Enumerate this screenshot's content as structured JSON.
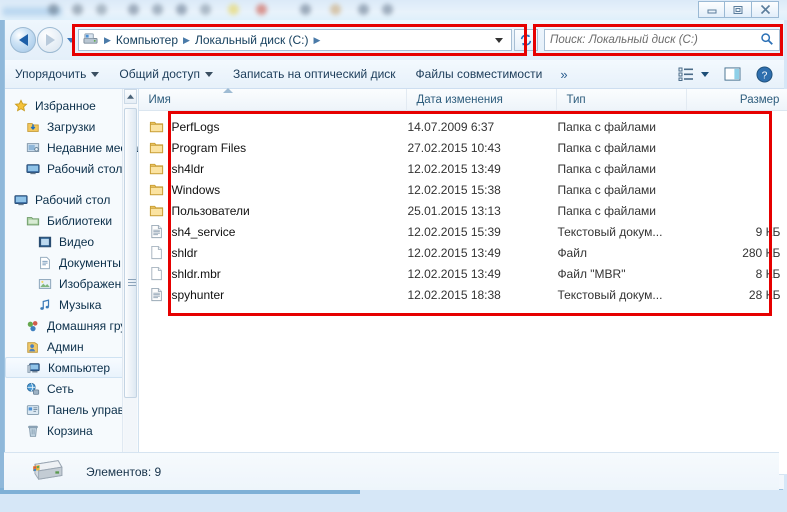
{
  "window": {
    "controls": {
      "minimize": "minimize-button",
      "maximize": "maximize-button",
      "close": "close-button"
    }
  },
  "address_bar": {
    "icon": "computer-drive-icon",
    "crumbs": [
      "Компьютер",
      "Локальный диск (C:)"
    ],
    "separator": "▶",
    "dropdown": "history-dropdown",
    "refresh_label": "Обновить",
    "back_label": "Назад",
    "forward_label": "Вперёд"
  },
  "search": {
    "placeholder": "Поиск: Локальный диск (C:)",
    "icon": "search-icon"
  },
  "toolbar": {
    "organize": "Упорядочить",
    "share": "Общий доступ",
    "burn": "Записать на оптический диск",
    "compat": "Файлы совместимости",
    "overflow": "»",
    "view_icon": "view-list-icon",
    "preview_icon": "preview-pane-icon",
    "help_icon": "help-icon"
  },
  "sidebar": {
    "groups": [
      {
        "items": [
          {
            "label": "Избранное",
            "icon": "star-icon",
            "indent": 0,
            "selected": false
          },
          {
            "label": "Загрузки",
            "icon": "downloads-icon",
            "indent": 1,
            "selected": false
          },
          {
            "label": "Недавние места",
            "icon": "recent-places-icon",
            "indent": 1,
            "selected": false
          },
          {
            "label": "Рабочий стол",
            "icon": "desktop-icon",
            "indent": 1,
            "selected": false
          }
        ]
      },
      {
        "items": [
          {
            "label": "Рабочий стол",
            "icon": "desktop-icon",
            "indent": 0,
            "selected": false
          },
          {
            "label": "Библиотеки",
            "icon": "libraries-icon",
            "indent": 1,
            "selected": false
          },
          {
            "label": "Видео",
            "icon": "video-icon",
            "indent": 2,
            "selected": false
          },
          {
            "label": "Документы",
            "icon": "documents-icon",
            "indent": 2,
            "selected": false
          },
          {
            "label": "Изображения",
            "icon": "pictures-icon",
            "indent": 2,
            "selected": false
          },
          {
            "label": "Музыка",
            "icon": "music-icon",
            "indent": 2,
            "selected": false
          },
          {
            "label": "Домашняя груп",
            "icon": "homegroup-icon",
            "indent": 1,
            "selected": false
          },
          {
            "label": "Админ",
            "icon": "user-icon",
            "indent": 1,
            "selected": false
          },
          {
            "label": "Компьютер",
            "icon": "computer-icon",
            "indent": 1,
            "selected": true
          },
          {
            "label": "Сеть",
            "icon": "network-icon",
            "indent": 1,
            "selected": false
          },
          {
            "label": "Панель управле",
            "icon": "control-panel-icon",
            "indent": 1,
            "selected": false
          },
          {
            "label": "Корзина",
            "icon": "recycle-bin-icon",
            "indent": 1,
            "selected": false
          }
        ]
      }
    ],
    "scrollbar": {
      "up": "scroll-up-arrow",
      "down": "scroll-down-arrow"
    }
  },
  "file_list": {
    "columns": [
      "Имя",
      "Дата изменения",
      "Тип",
      "Размер"
    ],
    "sort_column": "Имя",
    "rows": [
      {
        "name": "PerfLogs",
        "date": "14.07.2009 6:37",
        "type": "Папка с файлами",
        "size": "",
        "icon": "folder-icon"
      },
      {
        "name": "Program Files",
        "date": "27.02.2015 10:43",
        "type": "Папка с файлами",
        "size": "",
        "icon": "folder-icon"
      },
      {
        "name": "sh4ldr",
        "date": "12.02.2015 13:49",
        "type": "Папка с файлами",
        "size": "",
        "icon": "folder-icon"
      },
      {
        "name": "Windows",
        "date": "12.02.2015 15:38",
        "type": "Папка с файлами",
        "size": "",
        "icon": "folder-icon"
      },
      {
        "name": "Пользователи",
        "date": "25.01.2015 13:13",
        "type": "Папка с файлами",
        "size": "",
        "icon": "folder-icon"
      },
      {
        "name": "sh4_service",
        "date": "12.02.2015 15:39",
        "type": "Текстовый докум...",
        "size": "9 КБ",
        "icon": "text-document-icon"
      },
      {
        "name": "shldr",
        "date": "12.02.2015 13:49",
        "type": "Файл",
        "size": "280 КБ",
        "icon": "blank-file-icon"
      },
      {
        "name": "shldr.mbr",
        "date": "12.02.2015 13:49",
        "type": "Файл \"MBR\"",
        "size": "8 КБ",
        "icon": "blank-file-icon"
      },
      {
        "name": "spyhunter",
        "date": "12.02.2015 18:38",
        "type": "Текстовый докум...",
        "size": "28 КБ",
        "icon": "text-document-icon"
      }
    ]
  },
  "status_bar": {
    "text": "Элементов: 9",
    "icon": "local-drive-icon"
  },
  "annotations": {
    "color": "#e60000",
    "boxes": [
      "address-bar-highlight",
      "search-box-highlight",
      "file-list-highlight"
    ]
  }
}
